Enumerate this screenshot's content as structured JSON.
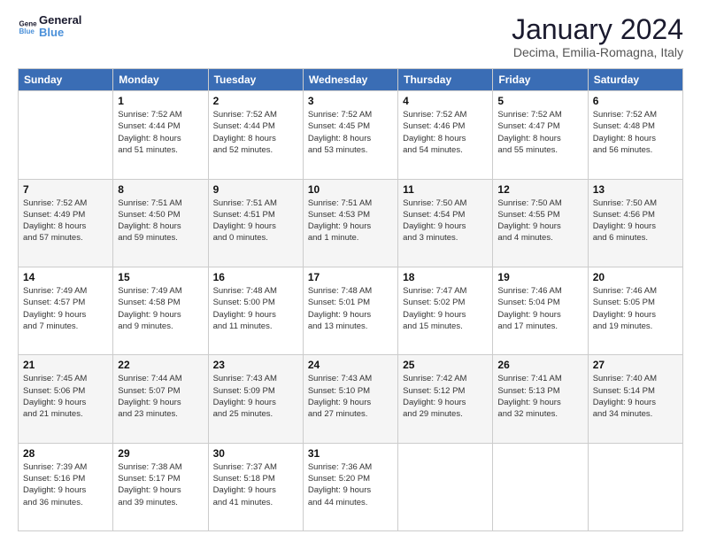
{
  "logo": {
    "line1": "General",
    "line2": "Blue"
  },
  "title": "January 2024",
  "subtitle": "Decima, Emilia-Romagna, Italy",
  "headers": [
    "Sunday",
    "Monday",
    "Tuesday",
    "Wednesday",
    "Thursday",
    "Friday",
    "Saturday"
  ],
  "weeks": [
    [
      {
        "day": "",
        "info": ""
      },
      {
        "day": "1",
        "info": "Sunrise: 7:52 AM\nSunset: 4:44 PM\nDaylight: 8 hours\nand 51 minutes."
      },
      {
        "day": "2",
        "info": "Sunrise: 7:52 AM\nSunset: 4:44 PM\nDaylight: 8 hours\nand 52 minutes."
      },
      {
        "day": "3",
        "info": "Sunrise: 7:52 AM\nSunset: 4:45 PM\nDaylight: 8 hours\nand 53 minutes."
      },
      {
        "day": "4",
        "info": "Sunrise: 7:52 AM\nSunset: 4:46 PM\nDaylight: 8 hours\nand 54 minutes."
      },
      {
        "day": "5",
        "info": "Sunrise: 7:52 AM\nSunset: 4:47 PM\nDaylight: 8 hours\nand 55 minutes."
      },
      {
        "day": "6",
        "info": "Sunrise: 7:52 AM\nSunset: 4:48 PM\nDaylight: 8 hours\nand 56 minutes."
      }
    ],
    [
      {
        "day": "7",
        "info": "Sunrise: 7:52 AM\nSunset: 4:49 PM\nDaylight: 8 hours\nand 57 minutes."
      },
      {
        "day": "8",
        "info": "Sunrise: 7:51 AM\nSunset: 4:50 PM\nDaylight: 8 hours\nand 59 minutes."
      },
      {
        "day": "9",
        "info": "Sunrise: 7:51 AM\nSunset: 4:51 PM\nDaylight: 9 hours\nand 0 minutes."
      },
      {
        "day": "10",
        "info": "Sunrise: 7:51 AM\nSunset: 4:53 PM\nDaylight: 9 hours\nand 1 minute."
      },
      {
        "day": "11",
        "info": "Sunrise: 7:50 AM\nSunset: 4:54 PM\nDaylight: 9 hours\nand 3 minutes."
      },
      {
        "day": "12",
        "info": "Sunrise: 7:50 AM\nSunset: 4:55 PM\nDaylight: 9 hours\nand 4 minutes."
      },
      {
        "day": "13",
        "info": "Sunrise: 7:50 AM\nSunset: 4:56 PM\nDaylight: 9 hours\nand 6 minutes."
      }
    ],
    [
      {
        "day": "14",
        "info": "Sunrise: 7:49 AM\nSunset: 4:57 PM\nDaylight: 9 hours\nand 7 minutes."
      },
      {
        "day": "15",
        "info": "Sunrise: 7:49 AM\nSunset: 4:58 PM\nDaylight: 9 hours\nand 9 minutes."
      },
      {
        "day": "16",
        "info": "Sunrise: 7:48 AM\nSunset: 5:00 PM\nDaylight: 9 hours\nand 11 minutes."
      },
      {
        "day": "17",
        "info": "Sunrise: 7:48 AM\nSunset: 5:01 PM\nDaylight: 9 hours\nand 13 minutes."
      },
      {
        "day": "18",
        "info": "Sunrise: 7:47 AM\nSunset: 5:02 PM\nDaylight: 9 hours\nand 15 minutes."
      },
      {
        "day": "19",
        "info": "Sunrise: 7:46 AM\nSunset: 5:04 PM\nDaylight: 9 hours\nand 17 minutes."
      },
      {
        "day": "20",
        "info": "Sunrise: 7:46 AM\nSunset: 5:05 PM\nDaylight: 9 hours\nand 19 minutes."
      }
    ],
    [
      {
        "day": "21",
        "info": "Sunrise: 7:45 AM\nSunset: 5:06 PM\nDaylight: 9 hours\nand 21 minutes."
      },
      {
        "day": "22",
        "info": "Sunrise: 7:44 AM\nSunset: 5:07 PM\nDaylight: 9 hours\nand 23 minutes."
      },
      {
        "day": "23",
        "info": "Sunrise: 7:43 AM\nSunset: 5:09 PM\nDaylight: 9 hours\nand 25 minutes."
      },
      {
        "day": "24",
        "info": "Sunrise: 7:43 AM\nSunset: 5:10 PM\nDaylight: 9 hours\nand 27 minutes."
      },
      {
        "day": "25",
        "info": "Sunrise: 7:42 AM\nSunset: 5:12 PM\nDaylight: 9 hours\nand 29 minutes."
      },
      {
        "day": "26",
        "info": "Sunrise: 7:41 AM\nSunset: 5:13 PM\nDaylight: 9 hours\nand 32 minutes."
      },
      {
        "day": "27",
        "info": "Sunrise: 7:40 AM\nSunset: 5:14 PM\nDaylight: 9 hours\nand 34 minutes."
      }
    ],
    [
      {
        "day": "28",
        "info": "Sunrise: 7:39 AM\nSunset: 5:16 PM\nDaylight: 9 hours\nand 36 minutes."
      },
      {
        "day": "29",
        "info": "Sunrise: 7:38 AM\nSunset: 5:17 PM\nDaylight: 9 hours\nand 39 minutes."
      },
      {
        "day": "30",
        "info": "Sunrise: 7:37 AM\nSunset: 5:18 PM\nDaylight: 9 hours\nand 41 minutes."
      },
      {
        "day": "31",
        "info": "Sunrise: 7:36 AM\nSunset: 5:20 PM\nDaylight: 9 hours\nand 44 minutes."
      },
      {
        "day": "",
        "info": ""
      },
      {
        "day": "",
        "info": ""
      },
      {
        "day": "",
        "info": ""
      }
    ]
  ]
}
